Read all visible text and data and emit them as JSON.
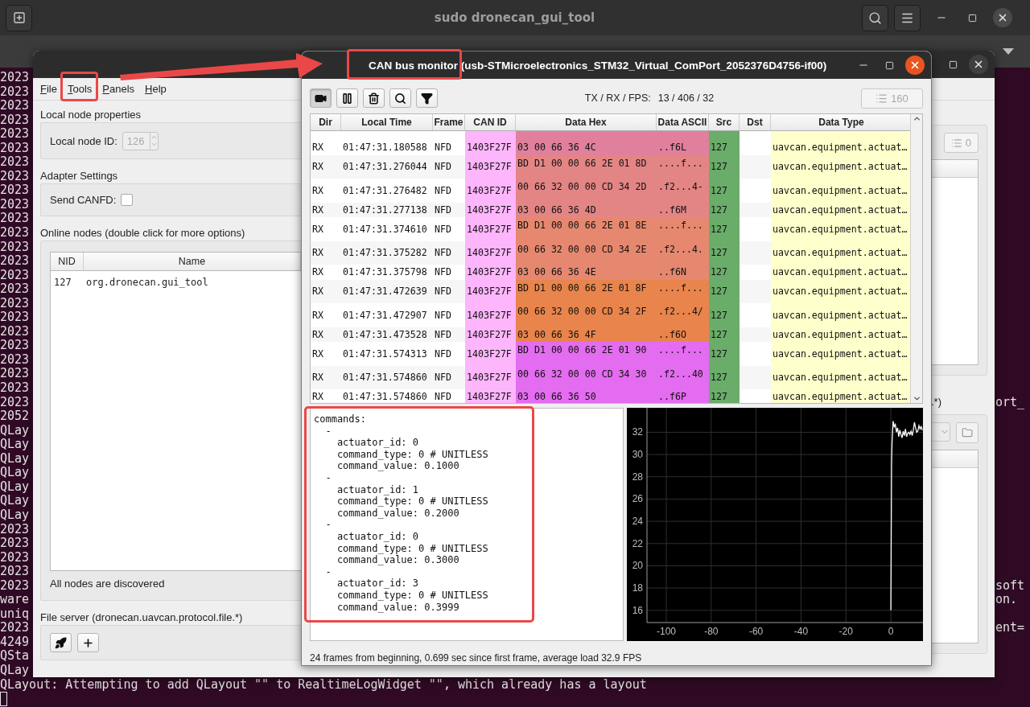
{
  "terminal": {
    "title": "sudo dronecan_gui_tool",
    "lines": [
      {
        "text": "2023"
      },
      {
        "text": "2023"
      },
      {
        "text": "2023"
      },
      {
        "text": "2023"
      },
      {
        "text": "2023"
      },
      {
        "text": "2023"
      },
      {
        "text": "2023"
      },
      {
        "text": "2023"
      },
      {
        "text": "2023"
      },
      {
        "text": "2023"
      },
      {
        "text": "2023"
      },
      {
        "text": "2023"
      },
      {
        "text": "2023"
      },
      {
        "text": "2023"
      },
      {
        "text": "2023"
      },
      {
        "text": "2023"
      },
      {
        "text": "2023"
      },
      {
        "text": "2023"
      },
      {
        "text": "2023"
      },
      {
        "text": "2023"
      },
      {
        "text": "2023"
      },
      {
        "text": "2023"
      },
      {
        "text": "2023"
      },
      {
        "text": "2023",
        "tail": "ort_"
      },
      {
        "text": "2052"
      },
      {
        "text": "QLay"
      },
      {
        "text": "QLay"
      },
      {
        "text": "QLay"
      },
      {
        "text": "QLay"
      },
      {
        "text": "QLay"
      },
      {
        "text": "QLay"
      },
      {
        "text": "QLay"
      },
      {
        "text": "2023"
      },
      {
        "text": "2023"
      },
      {
        "text": "2023"
      },
      {
        "text": "2023"
      },
      {
        "text": "2023",
        "tail": "soft"
      },
      {
        "text": "ware",
        "tail": "on."
      },
      {
        "text": "uniq"
      },
      {
        "text": "2023",
        "tail": "ent="
      },
      {
        "text": "4249"
      },
      {
        "text": "QSta"
      },
      {
        "text": "QLay"
      },
      {
        "text": "QLayout: Attempting to add QLayout \"\" to RealtimeLogWidget \"\", which already has a layout"
      }
    ]
  },
  "main_window": {
    "menu": [
      "File",
      "Tools",
      "Panels",
      "Help"
    ],
    "local_node": {
      "title": "Local node properties",
      "label": "Local node ID:",
      "value": "126",
      "disabled": true
    },
    "adapter": {
      "title": "Adapter Settings",
      "label": "Send CANFD:",
      "checked": false
    },
    "nodes": {
      "title": "Online nodes (double click for more options)",
      "columns": [
        "NID",
        "Name"
      ],
      "rows": [
        {
          "nid": "127",
          "name": "org.dronecan.gui_tool"
        }
      ],
      "status": "All nodes are discovered"
    },
    "file_server": {
      "title": "File server (dronecan.uavcan.protocol.file.*)",
      "buttons": [
        {
          "kind": "rocket"
        },
        {
          "kind": "add"
        }
      ]
    },
    "right_pane": {
      "count_button": {
        "label": "0",
        "disabled": true
      },
      "caption": ".*)"
    }
  },
  "monitor": {
    "title": "CAN bus monitor (usb-STMicroelectronics_STM32_Virtual_ComPort_2052376D4756-if00)",
    "toolbar": [
      {
        "kind": "camera",
        "pressed": true
      },
      {
        "kind": "pause",
        "pressed": false
      },
      {
        "kind": "trash",
        "pressed": false
      },
      {
        "kind": "search",
        "pressed": false
      },
      {
        "kind": "filter",
        "pressed": false
      }
    ],
    "stats_label": "TX / RX / FPS:",
    "stats_value": "13 / 406 / 32",
    "count_button": {
      "label": "160",
      "disabled": true
    },
    "table": {
      "columns": [
        "Dir",
        "Local Time",
        "Frame",
        "CAN ID",
        "Data Hex",
        "Data ASCII",
        "Src",
        "Dst",
        "Data Type"
      ],
      "rows": [
        {
          "dir": "RX",
          "time": "01:47:31.180588",
          "frame": "NFD",
          "can_id": "1403F27F",
          "hex": "03 00 66 36 4C",
          "ascii": "..f6L",
          "src": "127",
          "type": "uavcan.equipment.actuat…",
          "color": "#e0809c"
        },
        {
          "dir": "RX",
          "time": "01:47:31.276044",
          "frame": "NFD",
          "can_id": "1403F27F",
          "hex": "BD D1 00 00 66 2E 01 8D",
          "ascii": "....f...",
          "src": "127",
          "type": "uavcan.equipment.actuat…",
          "color": "#e48585"
        },
        {
          "dir": "RX",
          "time": "01:47:31.276482",
          "frame": "NFD",
          "can_id": "1403F27F",
          "hex": "00 66 32 00 00 CD 34 2D",
          "ascii": ".f2...4-",
          "src": "127",
          "type": "uavcan.equipment.actuat…",
          "color": "#e48585"
        },
        {
          "dir": "RX",
          "time": "01:47:31.277138",
          "frame": "NFD",
          "can_id": "1403F27F",
          "hex": "03 00 66 36 4D",
          "ascii": "..f6M",
          "src": "127",
          "type": "uavcan.equipment.actuat…",
          "color": "#e48585"
        },
        {
          "dir": "RX",
          "time": "01:47:31.374610",
          "frame": "NFD",
          "can_id": "1403F27F",
          "hex": "BD D1 00 00 66 2E 01 8E",
          "ascii": "....f...",
          "src": "127",
          "type": "uavcan.equipment.actuat…",
          "color": "#e6886f"
        },
        {
          "dir": "RX",
          "time": "01:47:31.375282",
          "frame": "NFD",
          "can_id": "1403F27F",
          "hex": "00 66 32 00 00 CD 34 2E",
          "ascii": ".f2...4.",
          "src": "127",
          "type": "uavcan.equipment.actuat…",
          "color": "#e6886f"
        },
        {
          "dir": "RX",
          "time": "01:47:31.375798",
          "frame": "NFD",
          "can_id": "1403F27F",
          "hex": "03 00 66 36 4E",
          "ascii": "..f6N",
          "src": "127",
          "type": "uavcan.equipment.actuat…",
          "color": "#e6886f"
        },
        {
          "dir": "RX",
          "time": "01:47:31.472639",
          "frame": "NFD",
          "can_id": "1403F27F",
          "hex": "BD D1 00 00 66 2E 01 8F",
          "ascii": "....f...",
          "src": "127",
          "type": "uavcan.equipment.actuat…",
          "color": "#e8844c"
        },
        {
          "dir": "RX",
          "time": "01:47:31.472907",
          "frame": "NFD",
          "can_id": "1403F27F",
          "hex": "00 66 32 00 00 CD 34 2F",
          "ascii": ".f2...4/",
          "src": "127",
          "type": "uavcan.equipment.actuat…",
          "color": "#e8844c"
        },
        {
          "dir": "RX",
          "time": "01:47:31.473528",
          "frame": "NFD",
          "can_id": "1403F27F",
          "hex": "03 00 66 36 4F",
          "ascii": "..f6O",
          "src": "127",
          "type": "uavcan.equipment.actuat…",
          "color": "#e8844c"
        },
        {
          "dir": "RX",
          "time": "01:47:31.574313",
          "frame": "NFD",
          "can_id": "1403F27F",
          "hex": "BD D1 00 00 66 2E 01 90",
          "ascii": "....f...",
          "src": "127",
          "type": "uavcan.equipment.actuat…",
          "color": "#e46cf0"
        },
        {
          "dir": "RX",
          "time": "01:47:31.574860",
          "frame": "NFD",
          "can_id": "1403F27F",
          "hex": "00 66 32 00 00 CD 34 30",
          "ascii": ".f2...40",
          "src": "127",
          "type": "uavcan.equipment.actuat…",
          "color": "#e46cf0"
        },
        {
          "dir": "RX",
          "time": "01:47:31.574860",
          "frame": "NFD",
          "can_id": "1403F27F",
          "hex": "03 00 66 36 50",
          "ascii": "..f6P",
          "src": "127",
          "type": "uavcan.equipment.actuat…",
          "color": "#e46cf0"
        }
      ]
    },
    "message": [
      "commands:",
      "  -",
      "    actuator_id: 0",
      "    command_type: 0 # UNITLESS",
      "    command_value: 0.1000",
      "  -",
      "    actuator_id: 1",
      "    command_type: 0 # UNITLESS",
      "    command_value: 0.2000",
      "  -",
      "    actuator_id: 0",
      "    command_type: 0 # UNITLESS",
      "    command_value: 0.3000",
      "  -",
      "    actuator_id: 3",
      "    command_type: 0 # UNITLESS",
      "    command_value: 0.3999"
    ],
    "chart_data": {
      "type": "line",
      "grid": true,
      "xlim": [
        -108.6,
        14.3
      ],
      "ylim": [
        14.9,
        34.2
      ],
      "xticks": [
        -100,
        -80,
        -60,
        -40,
        -20,
        0
      ],
      "yticks": [
        16,
        18,
        20,
        22,
        24,
        26,
        28,
        30,
        32
      ],
      "x": [
        0,
        0.1,
        0.3,
        0.5,
        1,
        1.5,
        2,
        2.5,
        3,
        3.5,
        4,
        4.5,
        5,
        5.5,
        6,
        6.5,
        7,
        7.5,
        8,
        8.5,
        9,
        9.5,
        10,
        10.5,
        11,
        11.5,
        12,
        12.5,
        13,
        13.5,
        14
      ],
      "series": [
        {
          "color": "#ffffff",
          "values": [
            16,
            20,
            29,
            31,
            33,
            32.5,
            32.7,
            32,
            32.4,
            31.6,
            32.2,
            31.8,
            31.5,
            32.1,
            31.7,
            32.3,
            31.6,
            31.9,
            32,
            31.8,
            32.1,
            31.7,
            32.2,
            32.9,
            32.4,
            32,
            32.1,
            32.6,
            32.3,
            32.5,
            32.2
          ]
        }
      ]
    },
    "status": "24 frames from beginning, 0.699 sec since first frame, average load 32.9 FPS"
  }
}
